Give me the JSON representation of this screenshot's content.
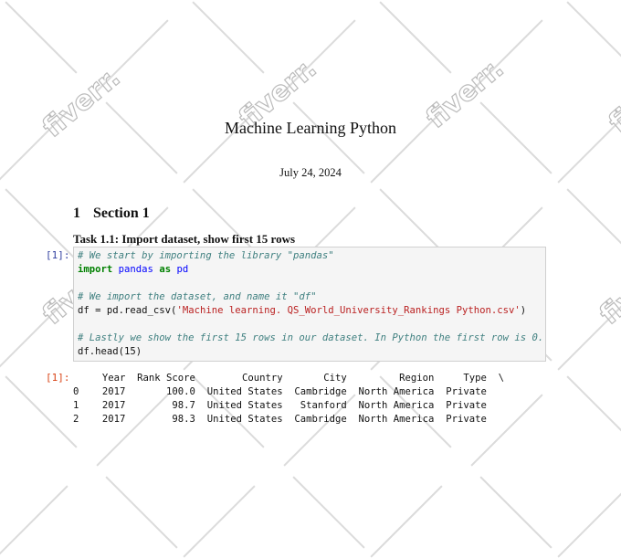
{
  "document": {
    "title": "Machine Learning Python",
    "date": "July 24, 2024",
    "section": {
      "number": "1",
      "title": "Section 1"
    },
    "task": "Task 1.1: Import dataset, show first 15 rows"
  },
  "cell": {
    "input_prompt": "[1]:",
    "output_prompt": "[1]:",
    "code": {
      "comment1": "# We start by importing the library \"pandas\"",
      "import_kw": "import",
      "module": "pandas",
      "as_kw": "as",
      "alias": "pd",
      "comment2": "# We import the dataset, and name it \"df\"",
      "read_prefix": "df = pd.read_csv(",
      "filename": "'Machine learning. QS_World_University_Rankings Python.csv'",
      "read_suffix": ")",
      "comment3": "# Lastly we show the first 15 rows in our dataset. In Python the first row is 0.",
      "head_call": "df.head(15)"
    },
    "output": {
      "header": "     Year  Rank Score        Country       City         Region     Type  \\",
      "rows": [
        "0    2017       100.0  United States  Cambridge  North America  Private",
        "1    2017        98.7  United States   Stanford  North America  Private",
        "2    2017        98.3  United States  Cambridge  North America  Private"
      ]
    }
  },
  "watermark": "fiverr."
}
